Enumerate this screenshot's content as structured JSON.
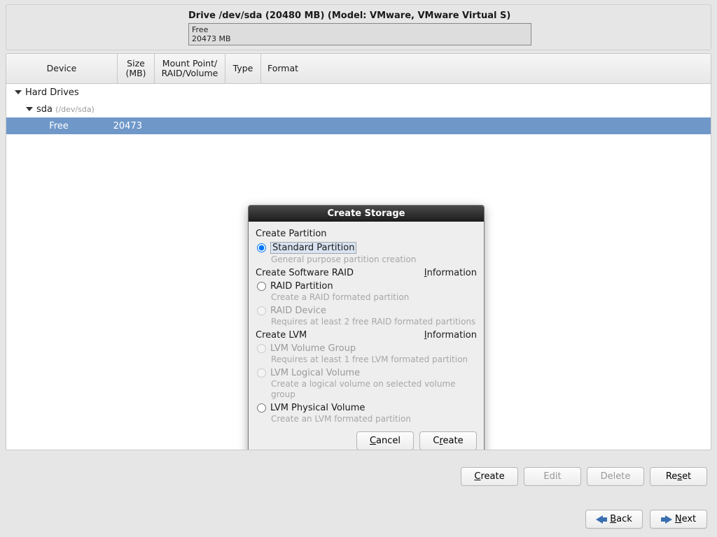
{
  "drive": {
    "title": "Drive /dev/sda (20480 MB) (Model: VMware, VMware Virtual S)",
    "block_label": "Free",
    "block_size": "20473 MB"
  },
  "columns": {
    "device": "Device",
    "size": "Size\n(MB)",
    "mount": "Mount Point/\nRAID/Volume",
    "type": "Type",
    "format": "Format"
  },
  "tree": {
    "root": "Hard Drives",
    "disk_name": "sda",
    "disk_path": "(/dev/sda)",
    "free_label": "Free",
    "free_size": "20473"
  },
  "dialog": {
    "title": "Create Storage",
    "section_partition": "Create Partition",
    "opt_standard": "Standard Partition",
    "hint_standard": "General purpose partition creation",
    "section_raid": "Create Software RAID",
    "info": "Information",
    "opt_raid_partition": "RAID Partition",
    "hint_raid_partition": "Create a RAID formated partition",
    "opt_raid_device": "RAID Device",
    "hint_raid_device": "Requires at least 2 free RAID formated partitions",
    "section_lvm": "Create LVM",
    "opt_lvm_vg": "LVM Volume Group",
    "hint_lvm_vg": "Requires at least 1 free LVM formated partition",
    "opt_lvm_lv": "LVM Logical Volume",
    "hint_lvm_lv": "Create a logical volume on selected volume group",
    "opt_lvm_pv": "LVM Physical Volume",
    "hint_lvm_pv": "Create an LVM formated partition",
    "cancel": "Cancel",
    "create": "Create"
  },
  "buttons": {
    "create": "Create",
    "edit": "Edit",
    "delete": "Delete",
    "reset": "Reset",
    "back": "Back",
    "next": "Next"
  }
}
